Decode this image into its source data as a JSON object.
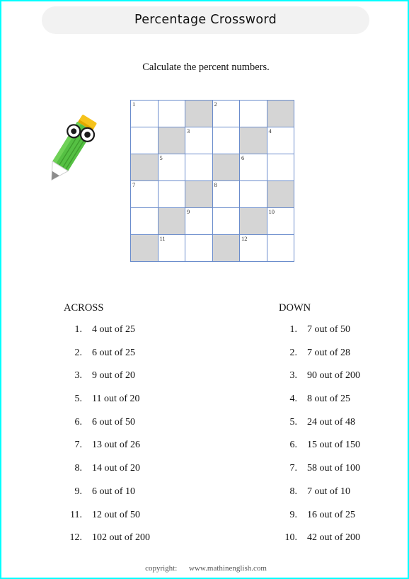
{
  "page": {
    "border_color": "#00ffff",
    "background": "#ffffff"
  },
  "header": {
    "title": "Percentage Crossword",
    "pill_color": "#f2f2f2"
  },
  "instruction": "Calculate the percent numbers.",
  "mascot": {
    "name": "pencil-character",
    "body_color": "#55c043",
    "body_dark": "#3f9e2e",
    "eraser_color": "#f5c21b",
    "tip_color": "#9a9a9a",
    "eye_color": "#ffffff",
    "pupil_color": "#1a1a1a"
  },
  "grid": {
    "rows": 6,
    "cols": 6,
    "line_color": "#6a8ccc",
    "shaded_color": "#d5d5d5",
    "empty_color": "#ffffff",
    "cells": [
      [
        {
          "num": "1",
          "shaded": false
        },
        {
          "num": "",
          "shaded": false
        },
        {
          "num": "",
          "shaded": true
        },
        {
          "num": "2",
          "shaded": false
        },
        {
          "num": "",
          "shaded": false
        },
        {
          "num": "",
          "shaded": true
        }
      ],
      [
        {
          "num": "",
          "shaded": false
        },
        {
          "num": "",
          "shaded": true
        },
        {
          "num": "3",
          "shaded": false
        },
        {
          "num": "",
          "shaded": false
        },
        {
          "num": "",
          "shaded": true
        },
        {
          "num": "4",
          "shaded": false
        }
      ],
      [
        {
          "num": "",
          "shaded": true
        },
        {
          "num": "5",
          "shaded": false
        },
        {
          "num": "",
          "shaded": false
        },
        {
          "num": "",
          "shaded": true
        },
        {
          "num": "6",
          "shaded": false
        },
        {
          "num": "",
          "shaded": false
        }
      ],
      [
        {
          "num": "7",
          "shaded": false
        },
        {
          "num": "",
          "shaded": false
        },
        {
          "num": "",
          "shaded": true
        },
        {
          "num": "8",
          "shaded": false
        },
        {
          "num": "",
          "shaded": false
        },
        {
          "num": "",
          "shaded": true
        }
      ],
      [
        {
          "num": "",
          "shaded": false
        },
        {
          "num": "",
          "shaded": true
        },
        {
          "num": "9",
          "shaded": false
        },
        {
          "num": "",
          "shaded": false
        },
        {
          "num": "",
          "shaded": true
        },
        {
          "num": "10",
          "shaded": false
        }
      ],
      [
        {
          "num": "",
          "shaded": true
        },
        {
          "num": "11",
          "shaded": false
        },
        {
          "num": "",
          "shaded": false
        },
        {
          "num": "",
          "shaded": true
        },
        {
          "num": "12",
          "shaded": false
        },
        {
          "num": "",
          "shaded": false
        }
      ]
    ]
  },
  "clues": {
    "across": {
      "heading": "ACROSS",
      "items": [
        {
          "num": "1.",
          "text": "4 out of 25"
        },
        {
          "num": "2.",
          "text": "6 out of 25"
        },
        {
          "num": "3.",
          "text": "9 out of 20"
        },
        {
          "num": "5.",
          "text": "11 out of 20"
        },
        {
          "num": "6.",
          "text": "6 out of 50"
        },
        {
          "num": "7.",
          "text": "13 out of 26"
        },
        {
          "num": "8.",
          "text": "14 out of 20"
        },
        {
          "num": "9.",
          "text": "6 out of 10"
        },
        {
          "num": "11.",
          "text": "12 out of 50"
        },
        {
          "num": "12.",
          "text": "102 out of 200"
        }
      ]
    },
    "down": {
      "heading": "DOWN",
      "items": [
        {
          "num": "1.",
          "text": "7 out of 50"
        },
        {
          "num": "2.",
          "text": "7 out of 28"
        },
        {
          "num": "3.",
          "text": "90 out of 200"
        },
        {
          "num": "4.",
          "text": "8 out of 25"
        },
        {
          "num": "5.",
          "text": "24 out of 48"
        },
        {
          "num": "6.",
          "text": "15 out of 150"
        },
        {
          "num": "7.",
          "text": "58 out of 100"
        },
        {
          "num": "8.",
          "text": "7 out of 10"
        },
        {
          "num": "9.",
          "text": "16 out of 25"
        },
        {
          "num": "10.",
          "text": "42 out of 200"
        }
      ]
    }
  },
  "footer": {
    "copyright_label": "copyright:",
    "site": "www.mathinenglish.com"
  }
}
